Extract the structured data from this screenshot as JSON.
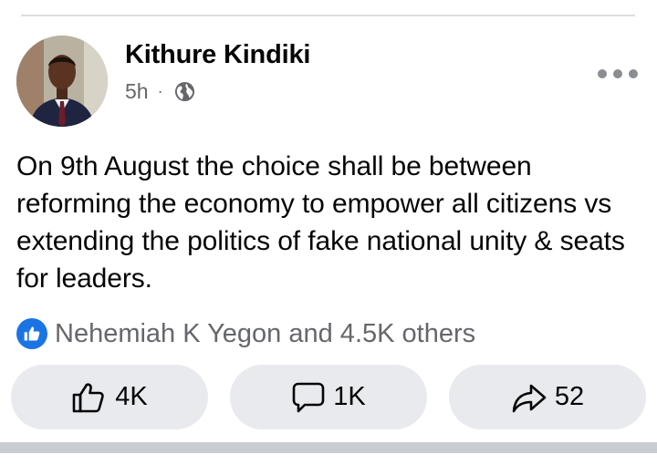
{
  "post": {
    "author": "Kithure Kindiki",
    "time": "5h",
    "separator": "·",
    "privacy_icon": "globe-icon",
    "text": "On 9th August the choice shall be between reforming the economy to empower all citizens vs extending the politics of fake national unity & seats for leaders."
  },
  "reactions": {
    "icon": "like-badge-icon",
    "summary": "Nehemiah K Yegon and 4.5K others"
  },
  "actions": {
    "like_count": "4K",
    "comment_count": "1K",
    "share_count": "52"
  },
  "colors": {
    "accent": "#1b74e4",
    "button_bg": "#e9eaee",
    "secondary_text": "#65676b"
  }
}
